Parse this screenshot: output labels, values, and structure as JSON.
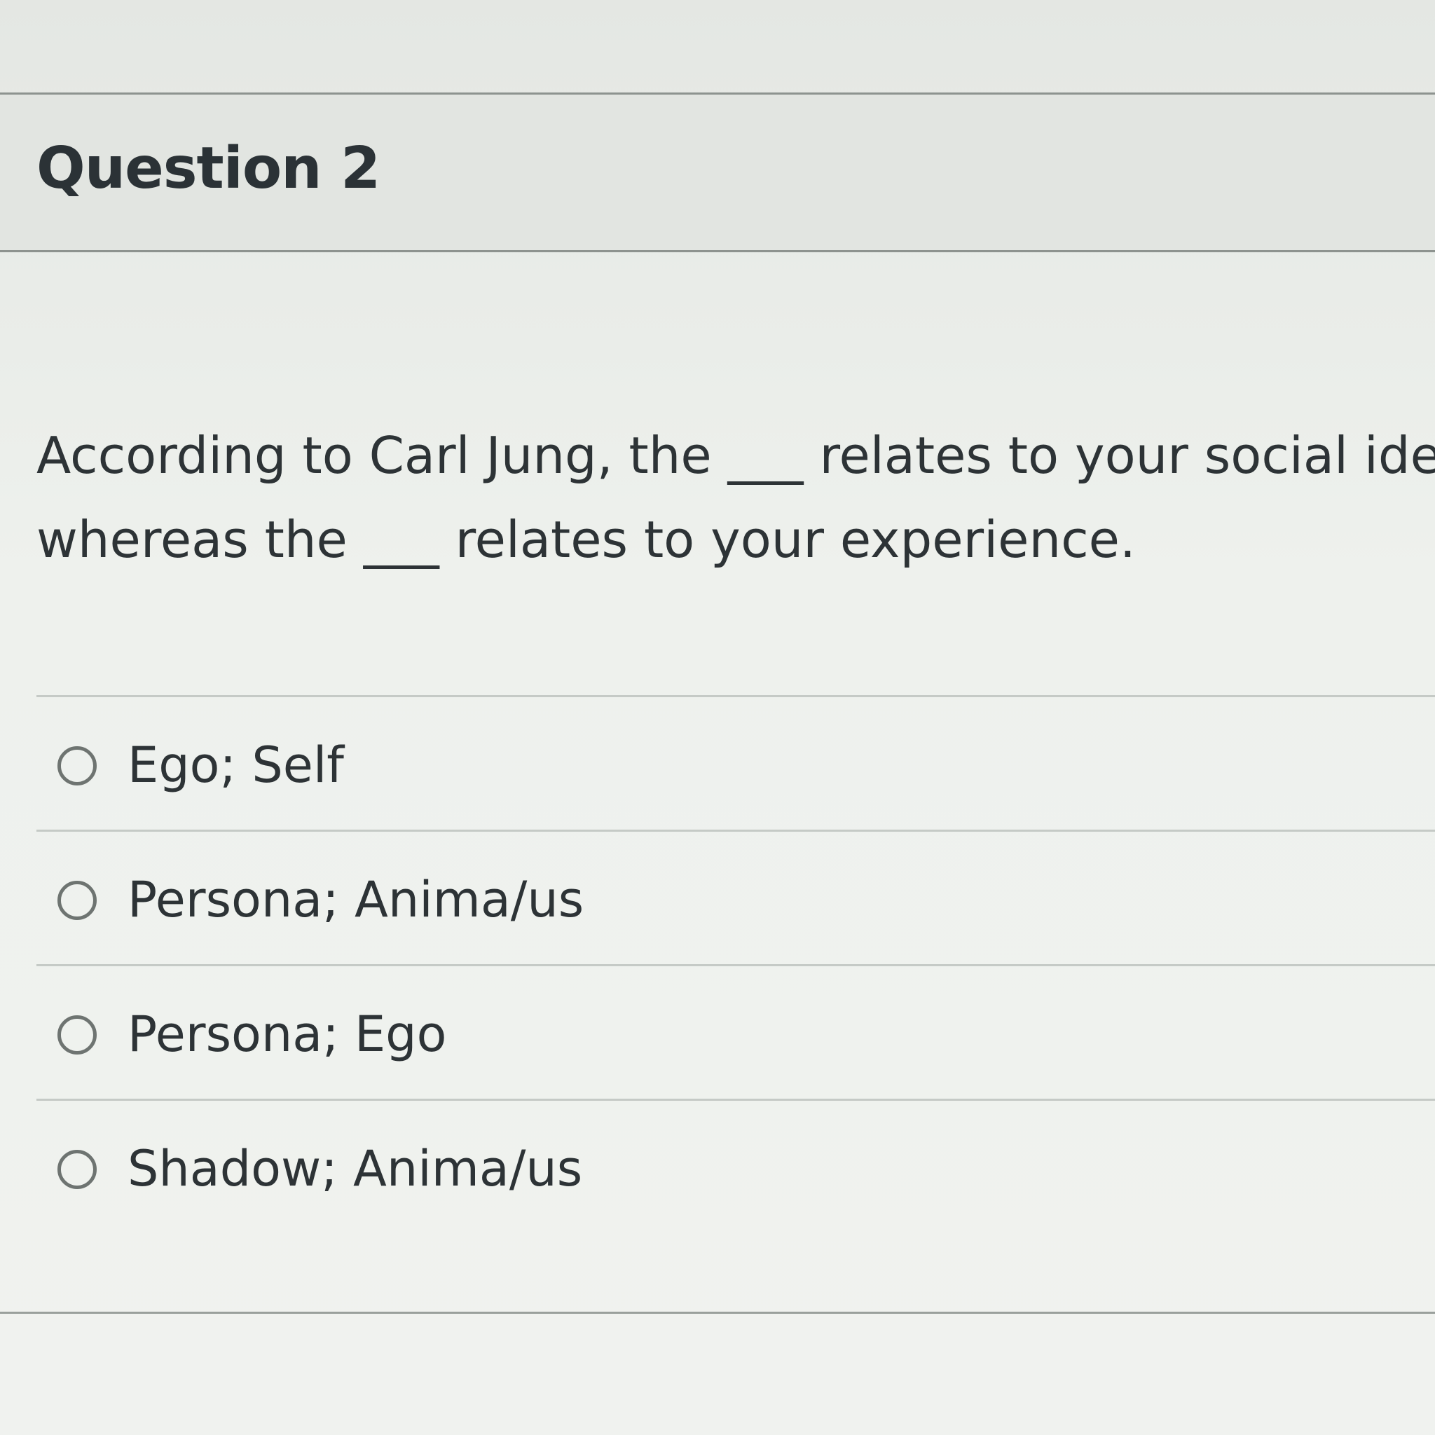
{
  "question": {
    "title": "Question 2",
    "text_line1": "According to Carl Jung, the ___ relates to your social ider",
    "text_line2": "whereas the ___ relates to your experience."
  },
  "answers": [
    {
      "label": "Ego; Self",
      "selected": false
    },
    {
      "label": "Persona; Anima/us",
      "selected": false
    },
    {
      "label": "Persona; Ego",
      "selected": false
    },
    {
      "label": "Shadow; Anima/us",
      "selected": false
    }
  ]
}
